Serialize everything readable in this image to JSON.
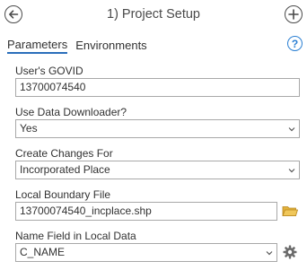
{
  "header": {
    "title": "1) Project Setup",
    "back_icon": "back-arrow-circle-icon",
    "add_icon": "add-circle-icon"
  },
  "tabs": [
    {
      "label": "Parameters",
      "active": true
    },
    {
      "label": "Environments",
      "active": false
    }
  ],
  "help_label": "?",
  "fields": {
    "govid": {
      "label": "User's GOVID",
      "value": "13700074540"
    },
    "downloader": {
      "label": "Use Data Downloader?",
      "value": "Yes"
    },
    "changes_for": {
      "label": "Create Changes For",
      "value": "Incorporated Place"
    },
    "boundary_file": {
      "label": "Local Boundary File",
      "value": "13700074540_incplace.shp",
      "icon": "folder-icon"
    },
    "name_field": {
      "label": "Name Field in Local Data",
      "value": "C_NAME",
      "icon": "gear-icon"
    }
  },
  "colors": {
    "accent": "#2a6ebb",
    "help": "#2a7fd3",
    "folder": "#e3b23c"
  }
}
